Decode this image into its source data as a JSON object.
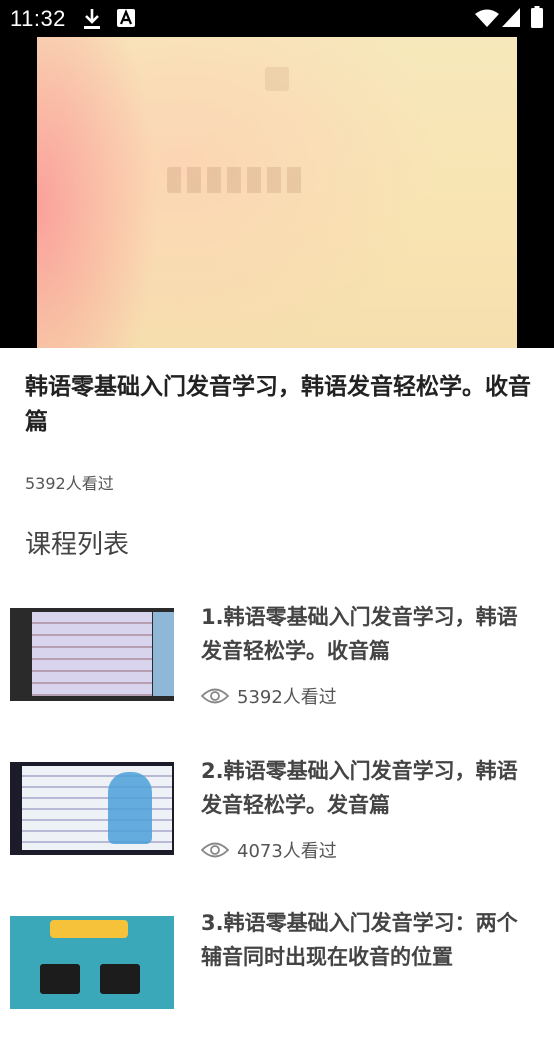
{
  "status_bar": {
    "time": "11:32",
    "icons": [
      "download-icon",
      "a-notification-icon",
      "wifi-icon",
      "signal-icon",
      "battery-icon"
    ]
  },
  "video": {
    "player": "video-player"
  },
  "course": {
    "title": "韩语零基础入门发音学习，韩语发音轻松学。收音篇",
    "viewers": "5392人看过"
  },
  "section_title": "课程列表",
  "lessons": [
    {
      "title": "1.韩语零基础入门发音学习，韩语发音轻松学。收音篇",
      "views": "5392人看过",
      "icon": "eye-icon"
    },
    {
      "title": "2.韩语零基础入门发音学习，韩语发音轻松学。发音篇",
      "views": "4073人看过",
      "icon": "eye-icon"
    },
    {
      "title": "3.韩语零基础入门发音学习：两个辅音同时出现在收音的位置",
      "views": "",
      "icon": "eye-icon"
    }
  ],
  "colors": {
    "status_bar": "#000000",
    "title_text": "#222222",
    "meta_text": "#555555"
  }
}
